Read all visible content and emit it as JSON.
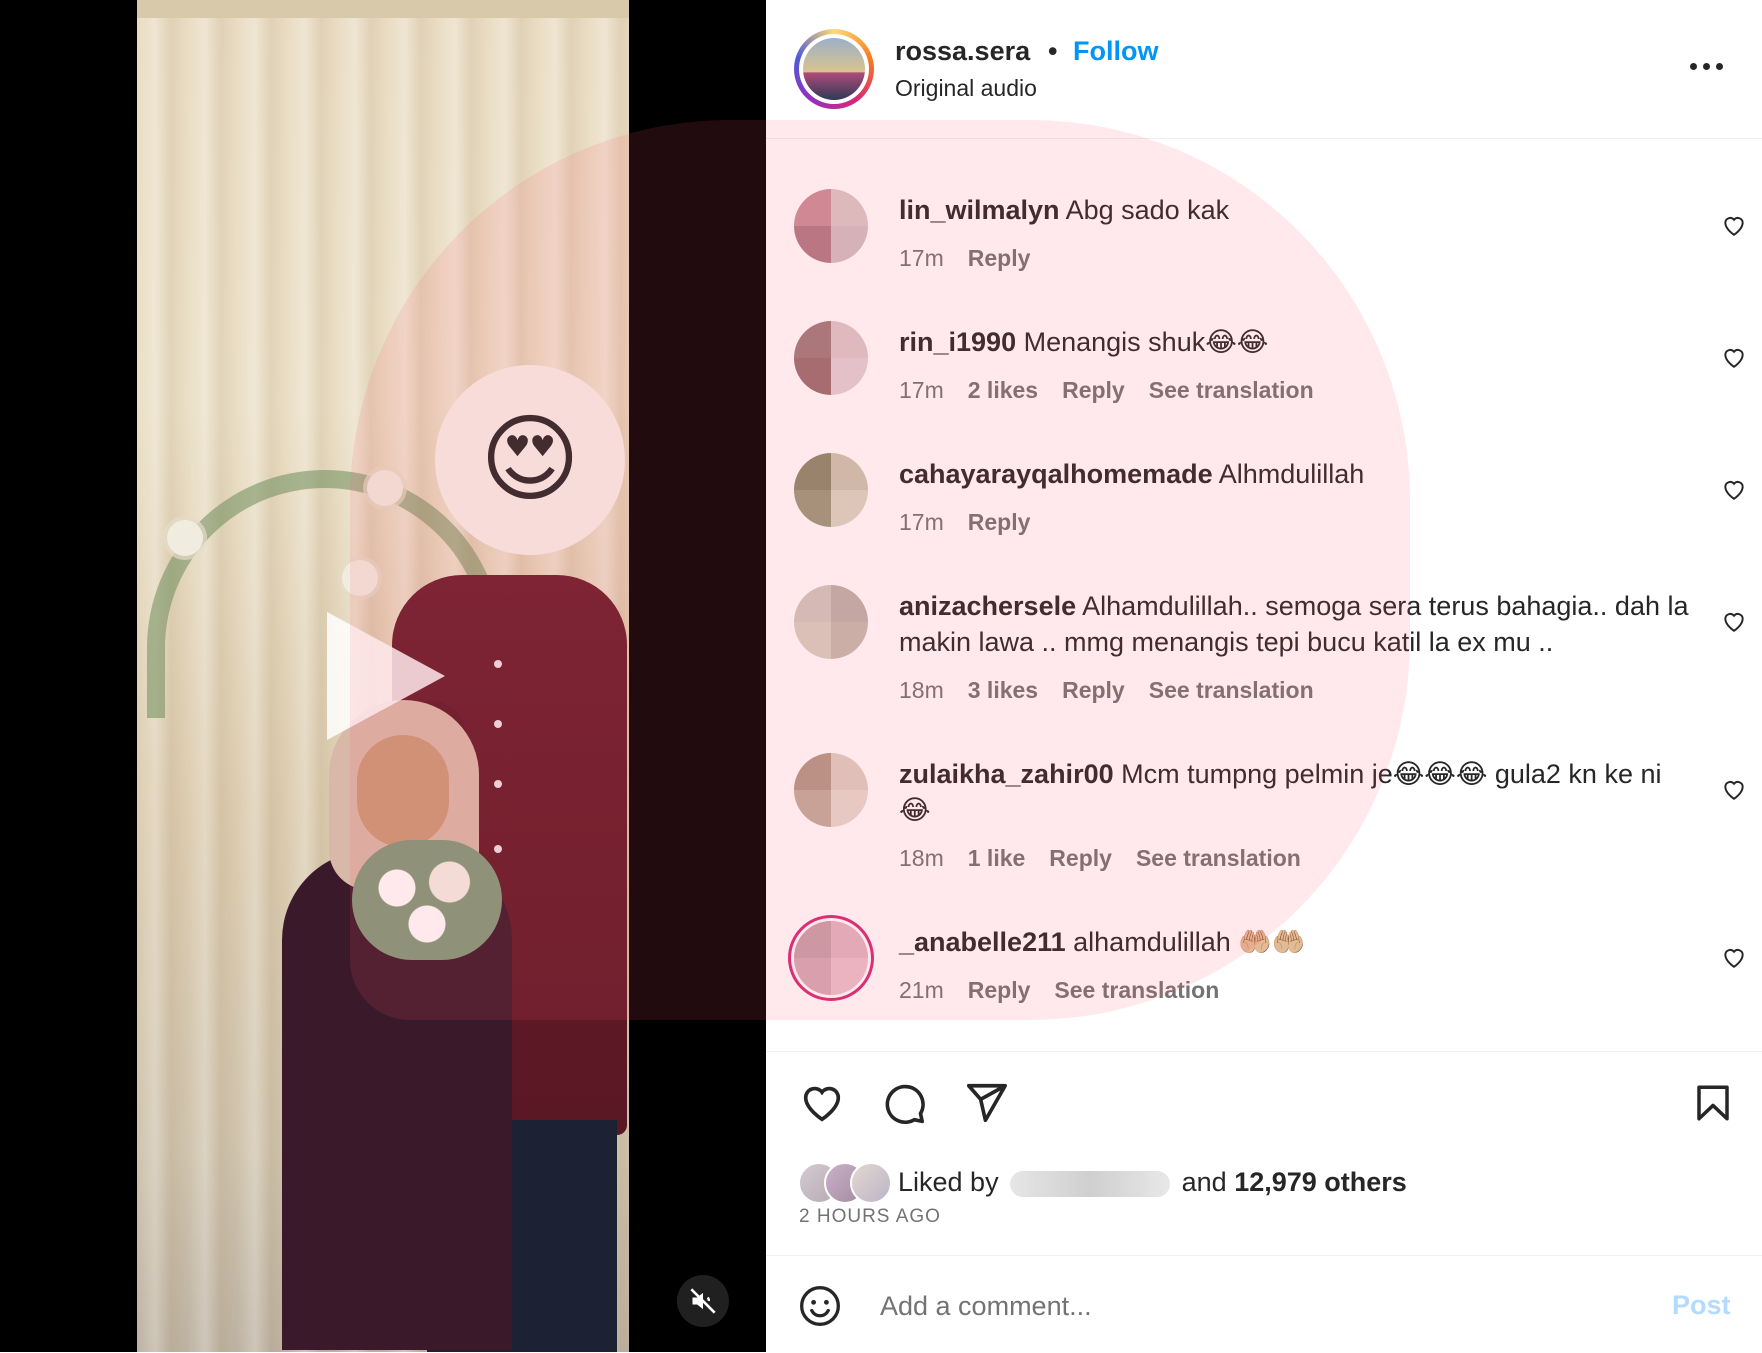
{
  "post": {
    "username": "rossa.sera",
    "separator": "•",
    "follow_label": "Follow",
    "audio": "Original audio"
  },
  "media": {
    "face_sticker": "😍",
    "play_icon": "play-icon",
    "mute_icon": "speaker-muted-icon"
  },
  "comments": [
    {
      "user": "lin_wilmalyn",
      "text": "Abg sado kak",
      "time": "17m",
      "likes": "",
      "reply": "Reply",
      "translation": "",
      "avatar_colors": [
        "#c8909a",
        "#d8c8c8",
        "#b07d87",
        "#d0c0c4"
      ]
    },
    {
      "user": "rin_i1990",
      "text": "Menangis shuk😂😂",
      "time": "17m",
      "likes": "2 likes",
      "reply": "Reply",
      "translation": "See translation",
      "avatar_colors": [
        "#a07c7c",
        "#dcc8cc",
        "#9a7070",
        "#e0d2d6"
      ]
    },
    {
      "user": "cahayarayqalhomemade",
      "text": "Alhmdulillah",
      "time": "17m",
      "likes": "",
      "reply": "Reply",
      "translation": "",
      "avatar_colors": [
        "#8a8a6e",
        "#c9c6b0",
        "#9c9a7e",
        "#d8d6c4"
      ]
    },
    {
      "user": "anizachersele",
      "text": "Alhamdulillah.. semoga sera terus bahagia.. dah la makin lawa .. mmg menangis tepi bucu katil la ex mu ..",
      "time": "18m",
      "likes": "3 likes",
      "reply": "Reply",
      "translation": "See translation",
      "avatar_colors": [
        "#cfc8c0",
        "#bcb4ac",
        "#d6d0c4",
        "#c4bdb0"
      ]
    },
    {
      "user": "zulaikha_zahir00",
      "text": "Mcm tumpng pelmin je😂😂😂 gula2 kn ke ni😂",
      "time": "18m",
      "likes": "1 like",
      "reply": "Reply",
      "translation": "See translation",
      "avatar_colors": [
        "#b09a88",
        "#dccfc4",
        "#c2ae9e",
        "#e4dad0"
      ]
    },
    {
      "user": "_anabelle211",
      "text": "alhamdulillah 🤲🏼🤲🏼",
      "time": "21m",
      "likes": "",
      "reply": "Reply",
      "translation": "See translation",
      "avatar_colors": [
        "#c7a2aa",
        "#e0b6c2",
        "#d4aab6",
        "#e8c2cc"
      ]
    }
  ],
  "actions": {
    "like_icon": "heart-icon",
    "comment_icon": "comment-icon",
    "share_icon": "send-icon",
    "save_icon": "bookmark-icon",
    "liked_prefix": "Liked by",
    "liked_and": "and",
    "liked_count": "12,979 others",
    "time_ago": "2 HOURS AGO"
  },
  "composer": {
    "placeholder": "Add a comment...",
    "post_label": "Post",
    "emoji_icon": "smiley-icon"
  },
  "colors": {
    "follow": "#0095f6",
    "meta": "#737373",
    "text": "#262626",
    "post_disabled": "#b3dbff"
  }
}
